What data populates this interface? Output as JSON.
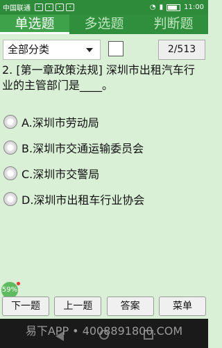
{
  "status_bar": {
    "carrier": "中国联通",
    "time": "11:00"
  },
  "tabs": [
    {
      "label": "单选题",
      "active": true
    },
    {
      "label": "多选题",
      "active": false
    },
    {
      "label": "判断题",
      "active": false
    }
  ],
  "toolbar": {
    "category_select": "全部分类",
    "counter": "2/513"
  },
  "question": {
    "text": "2. [第一章政策法规] 深圳市出租汽车行业的主管部门是____。"
  },
  "options": [
    {
      "label": "A.深圳市劳动局"
    },
    {
      "label": "B.深圳市交通运输委员会"
    },
    {
      "label": "C.深圳市交警局"
    },
    {
      "label": "D.深圳市出租车行业协会"
    }
  ],
  "progress_badge": "59%",
  "buttons": {
    "next": "下一题",
    "prev": "上一题",
    "answer": "答案",
    "menu": "菜单"
  },
  "watermark": "易下APP • 4008891800.COM"
}
